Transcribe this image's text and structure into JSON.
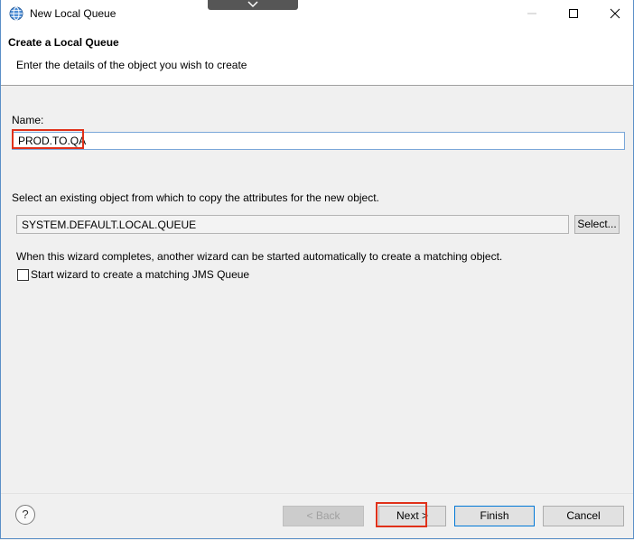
{
  "window": {
    "title": "New Local Queue",
    "controls": {
      "minimize": "minimize-icon",
      "maximize": "maximize-icon",
      "close": "close-icon"
    }
  },
  "header": {
    "title": "Create a Local Queue",
    "description": "Enter the details of the object you wish to create"
  },
  "form": {
    "name_label": "Name:",
    "name_value": "PROD.TO.QA",
    "copy_label": "Select an existing object from which to copy the attributes for the new object.",
    "copy_value": "SYSTEM.DEFAULT.LOCAL.QUEUE",
    "select_button": "Select...",
    "wizard_text": "When this wizard completes, another wizard can be started automatically to create a matching object.",
    "checkbox_label": "Start wizard to create a matching JMS Queue",
    "checkbox_checked": false
  },
  "footer": {
    "help": "?",
    "back": "< Back",
    "next": "Next >",
    "finish": "Finish",
    "cancel": "Cancel"
  },
  "colors": {
    "highlight": "#e0311a",
    "focus_border": "#0078d7"
  }
}
